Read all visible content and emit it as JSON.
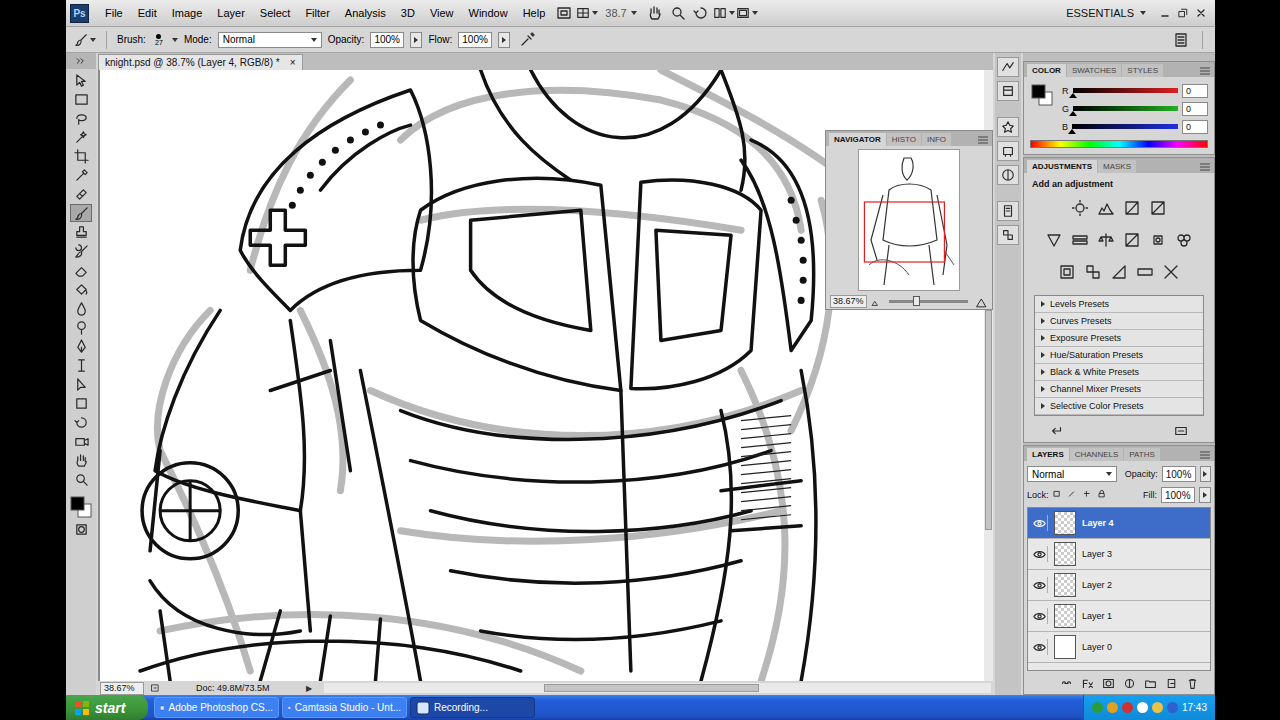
{
  "app": {
    "logo": "Ps",
    "menus": [
      "File",
      "Edit",
      "Image",
      "Layer",
      "Select",
      "Filter",
      "Analysis",
      "3D",
      "View",
      "Window",
      "Help"
    ],
    "zoom": "38.7",
    "workspace": "ESSENTIALS"
  },
  "options": {
    "brush_label": "Brush:",
    "brush_size": "27",
    "mode_label": "Mode:",
    "mode": "Normal",
    "opacity_label": "Opacity:",
    "opacity": "100%",
    "flow_label": "Flow:",
    "flow": "100%"
  },
  "document": {
    "tab": "knight.psd @ 38.7% (Layer 4, RGB/8) *",
    "close": "×"
  },
  "tools": [
    {
      "selected": false
    },
    {
      "selected": false
    },
    {
      "selected": false
    },
    {
      "selected": false
    },
    {
      "selected": false
    },
    {
      "selected": false
    },
    {
      "selected": false
    },
    {
      "selected": true
    },
    {
      "selected": false
    },
    {
      "selected": false
    },
    {
      "selected": false
    },
    {
      "selected": false
    },
    {
      "selected": false
    },
    {
      "selected": false
    },
    {
      "selected": false
    },
    {
      "selected": false
    },
    {
      "selected": false
    },
    {
      "selected": false
    },
    {
      "selected": false
    },
    {
      "selected": false
    },
    {
      "selected": false
    },
    {
      "selected": false
    }
  ],
  "status_bar": {
    "zoom": "38.67%",
    "doc": "Doc: 49.8M/73.5M",
    "arrow": "▶"
  },
  "navigator": {
    "tabs": [
      {
        "label": "NAVIGATOR",
        "selected": true
      },
      {
        "label": "HISTO",
        "selected": false
      },
      {
        "label": "INFO",
        "selected": false
      }
    ],
    "zoom": "38.67%",
    "level": 0.35
  },
  "color_panel": {
    "tabs": [
      {
        "label": "COLOR",
        "selected": true
      },
      {
        "label": "SWATCHES",
        "selected": false
      },
      {
        "label": "STYLES",
        "selected": false
      }
    ],
    "channels": [
      {
        "name": "R",
        "value": "0",
        "level": 0,
        "color": "#e02020"
      },
      {
        "name": "G",
        "value": "0",
        "level": 0,
        "color": "#20b020"
      },
      {
        "name": "B",
        "value": "0",
        "level": 0,
        "color": "#2030e0"
      }
    ]
  },
  "adjustments": {
    "tabs": [
      {
        "label": "ADJUSTMENTS",
        "selected": true
      },
      {
        "label": "MASKS",
        "selected": false
      }
    ],
    "title": "Add an adjustment",
    "presets": [
      "Levels Presets",
      "Curves Presets",
      "Exposure Presets",
      "Hue/Saturation Presets",
      "Black & White Presets",
      "Channel Mixer Presets",
      "Selective Color Presets"
    ]
  },
  "layers": {
    "tabs": [
      {
        "label": "LAYERS",
        "selected": true
      },
      {
        "label": "CHANNELS",
        "selected": false
      },
      {
        "label": "PATHS",
        "selected": false
      }
    ],
    "blend_mode": "Normal",
    "opacity_label": "Opacity:",
    "opacity": "100%",
    "lock_label": "Lock:",
    "fill_label": "Fill:",
    "fill": "100%",
    "items": [
      {
        "name": "Layer 4",
        "selected": true,
        "visible": true,
        "kind": "transparent"
      },
      {
        "name": "Layer 3",
        "selected": false,
        "visible": true,
        "kind": "transparent"
      },
      {
        "name": "Layer 2",
        "selected": false,
        "visible": true,
        "kind": "transparent"
      },
      {
        "name": "Layer 1",
        "selected": false,
        "visible": true,
        "kind": "transparent"
      },
      {
        "name": "Layer 0",
        "selected": false,
        "visible": true,
        "kind": "filled"
      }
    ]
  },
  "taskbar": {
    "start": "start",
    "items": [
      {
        "label": "Adobe Photoshop CS...",
        "selected": false
      },
      {
        "label": "Camtasia Studio - Unt...",
        "selected": false
      },
      {
        "label": "Recording...",
        "selected": true
      }
    ],
    "clock": "17:43"
  }
}
